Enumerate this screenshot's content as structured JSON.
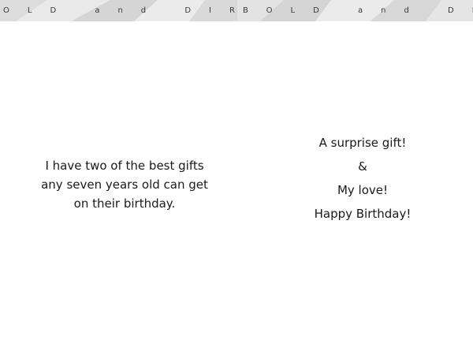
{
  "banner": {
    "left_text": "OLD and DIRECT",
    "right_text": "BOLD and DIREC",
    "colors": {
      "background": "#e6e6e6",
      "facets": "#d2d2d2",
      "text": "#3a3a3a"
    }
  },
  "left_panel": {
    "lines": [
      "I have two of the best gifts",
      "any seven years old can get",
      "on their birthday."
    ]
  },
  "right_panel": {
    "lines": [
      "A surprise gift!",
      "&",
      "My love!",
      "Happy Birthday!"
    ]
  }
}
